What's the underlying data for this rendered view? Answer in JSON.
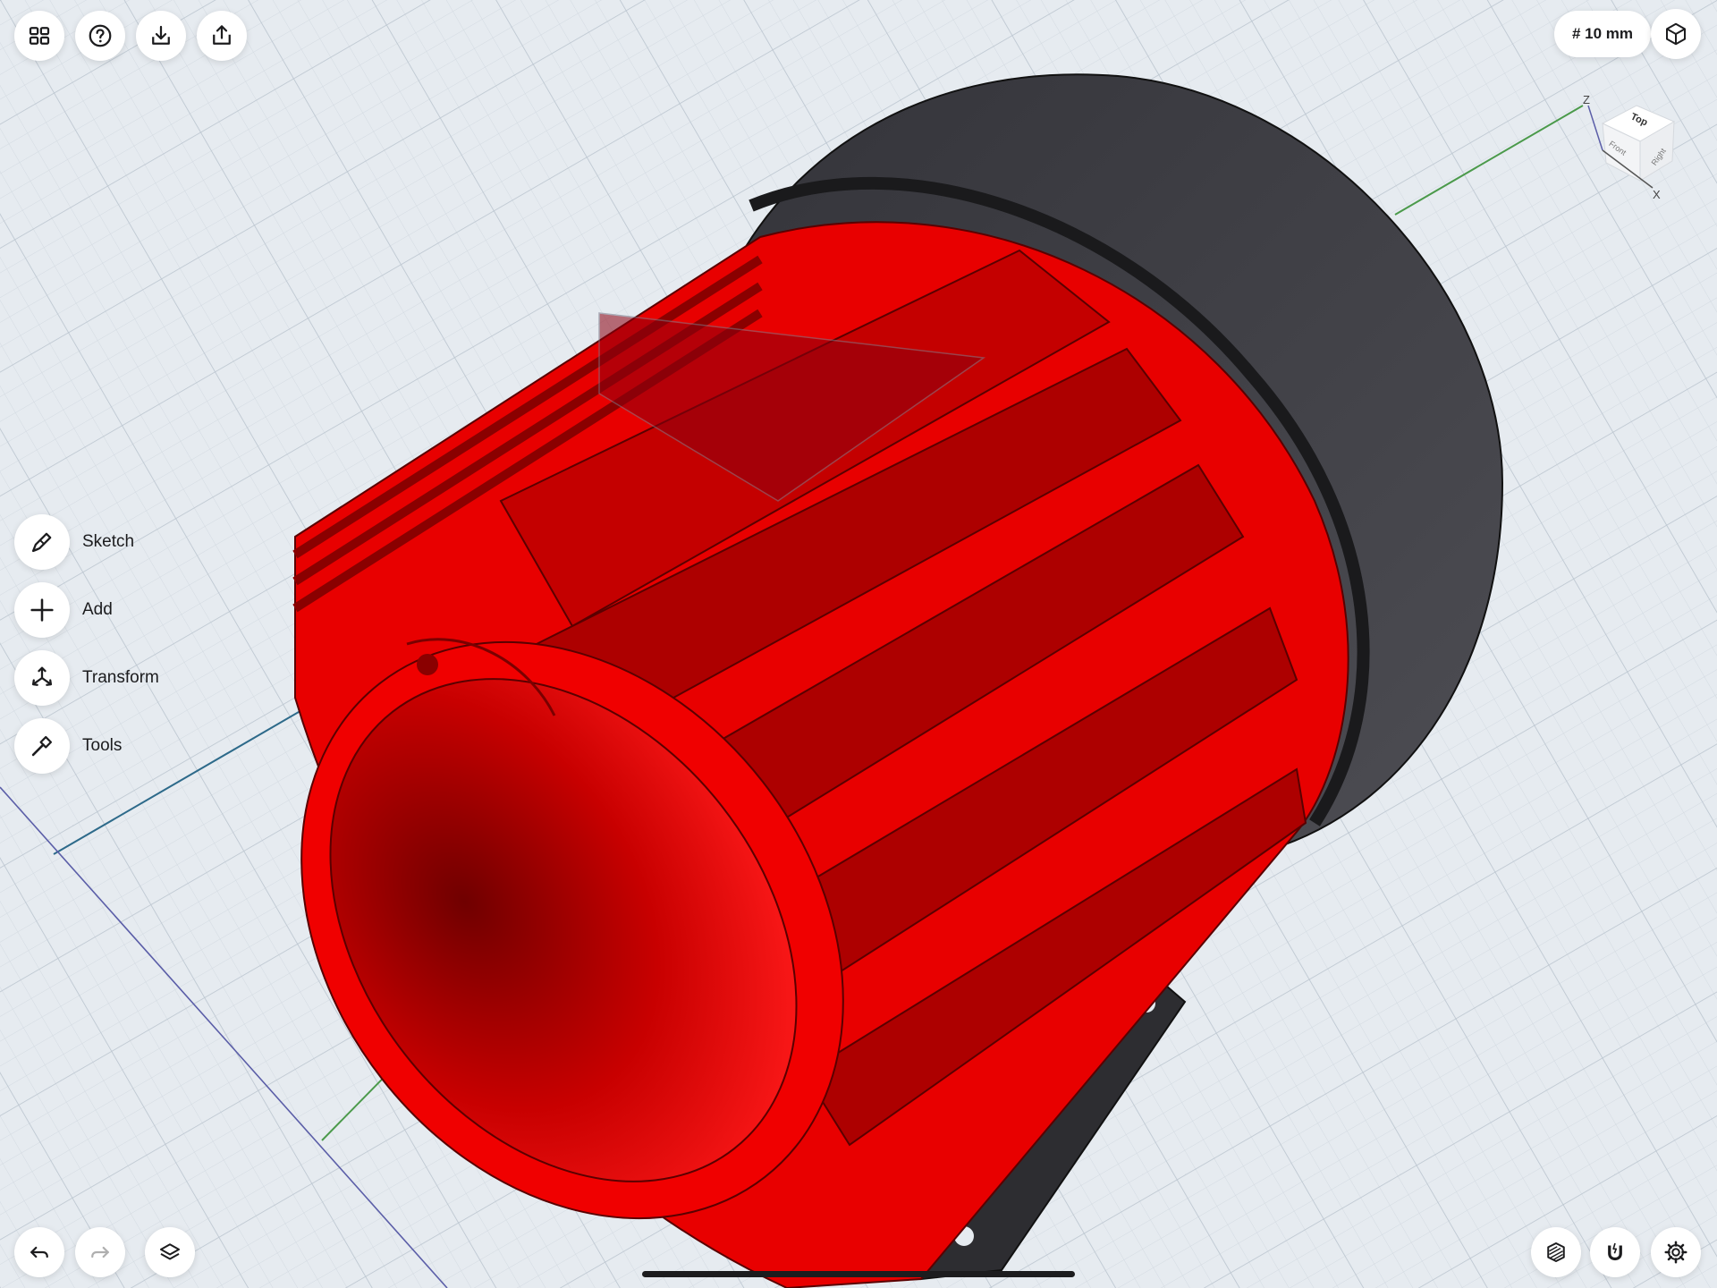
{
  "toolbar": {
    "icons": [
      "projects-grid-icon",
      "help-icon",
      "import-icon",
      "export-icon"
    ]
  },
  "grid_size": {
    "label": "# 10 mm"
  },
  "view_mode_icon": "perspective-cube-icon",
  "view_cube": {
    "top": "Top",
    "front": "Front",
    "right": "Right",
    "z_axis": "Z",
    "x_axis": "X"
  },
  "side_menu": [
    {
      "label": "Sketch",
      "icon": "sketch-pen-icon"
    },
    {
      "label": "Add",
      "icon": "plus-icon"
    },
    {
      "label": "Transform",
      "icon": "transform-icon"
    },
    {
      "label": "Tools",
      "icon": "hammer-icon"
    }
  ],
  "bottom_left": {
    "icons": [
      "undo-icon",
      "redo-icon",
      "layers-icon"
    ]
  },
  "bottom_right": {
    "icons": [
      "section-view-icon",
      "snap-magnet-icon",
      "settings-gear-icon"
    ]
  },
  "colors": {
    "model_red": "#e80000",
    "model_dark_red": "#9c0000",
    "cover_dark": "#3f3f43",
    "background": "#e6ebf0",
    "grid_line": "#c9d2db"
  }
}
